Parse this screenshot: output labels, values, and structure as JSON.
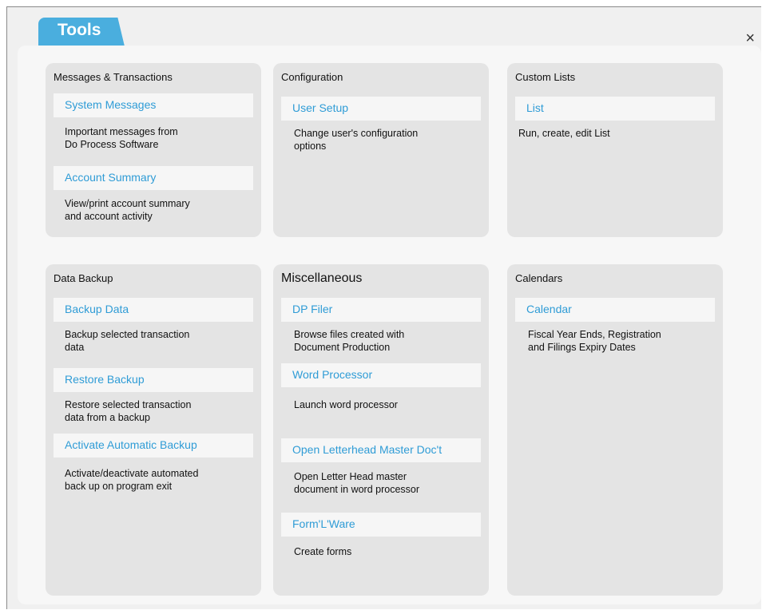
{
  "window": {
    "tab_label": "Tools",
    "close_glyph": "×"
  },
  "cards": {
    "messages": {
      "title": "Messages & Transactions",
      "items": [
        {
          "label": "System Messages",
          "desc": "Important messages from\nDo Process Software"
        },
        {
          "label": "Account Summary",
          "desc": "View/print account summary\nand account activity"
        }
      ]
    },
    "configuration": {
      "title": "Configuration",
      "items": [
        {
          "label": "User Setup",
          "desc": "Change user's configuration\noptions"
        }
      ]
    },
    "custom_lists": {
      "title": "Custom Lists",
      "items": [
        {
          "label": "List",
          "desc": "Run, create, edit List"
        }
      ]
    },
    "data_backup": {
      "title": "Data Backup",
      "items": [
        {
          "label": "Backup Data",
          "desc": "Backup selected transaction\ndata"
        },
        {
          "label": "Restore Backup",
          "desc": "Restore selected transaction\ndata from a backup"
        },
        {
          "label": "Activate Automatic Backup",
          "desc": "Activate/deactivate automated\nback up on program exit"
        }
      ]
    },
    "misc": {
      "title": "Miscellaneous",
      "items": [
        {
          "label": "DP Filer",
          "desc": "Browse files created with\nDocument Production"
        },
        {
          "label": "Word Processor",
          "desc": "Launch word processor"
        },
        {
          "label": "Open Letterhead Master Doc't",
          "desc": "Open Letter Head master\ndocument in word processor"
        },
        {
          "label": "Form'L'Ware",
          "desc": "Create forms"
        }
      ]
    },
    "calendars": {
      "title": "Calendars",
      "items": [
        {
          "label": "Calendar",
          "desc": "Fiscal Year Ends, Registration\nand Filings Expiry Dates"
        }
      ]
    }
  }
}
